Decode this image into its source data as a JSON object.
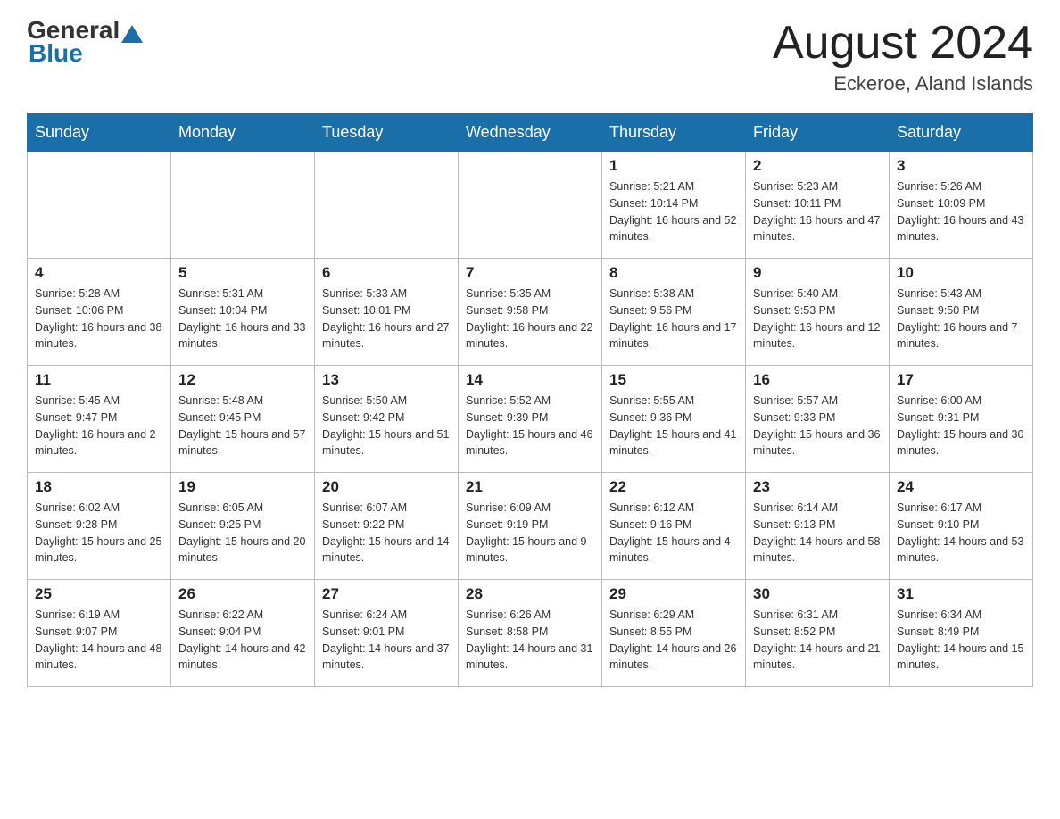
{
  "header": {
    "logo": {
      "general": "General",
      "blue": "Blue"
    },
    "title": "August 2024",
    "subtitle": "Eckeroe, Aland Islands"
  },
  "days_of_week": [
    "Sunday",
    "Monday",
    "Tuesday",
    "Wednesday",
    "Thursday",
    "Friday",
    "Saturday"
  ],
  "weeks": [
    [
      {
        "day": "",
        "sunrise": "",
        "sunset": "",
        "daylight": ""
      },
      {
        "day": "",
        "sunrise": "",
        "sunset": "",
        "daylight": ""
      },
      {
        "day": "",
        "sunrise": "",
        "sunset": "",
        "daylight": ""
      },
      {
        "day": "",
        "sunrise": "",
        "sunset": "",
        "daylight": ""
      },
      {
        "day": "1",
        "sunrise": "Sunrise: 5:21 AM",
        "sunset": "Sunset: 10:14 PM",
        "daylight": "Daylight: 16 hours and 52 minutes."
      },
      {
        "day": "2",
        "sunrise": "Sunrise: 5:23 AM",
        "sunset": "Sunset: 10:11 PM",
        "daylight": "Daylight: 16 hours and 47 minutes."
      },
      {
        "day": "3",
        "sunrise": "Sunrise: 5:26 AM",
        "sunset": "Sunset: 10:09 PM",
        "daylight": "Daylight: 16 hours and 43 minutes."
      }
    ],
    [
      {
        "day": "4",
        "sunrise": "Sunrise: 5:28 AM",
        "sunset": "Sunset: 10:06 PM",
        "daylight": "Daylight: 16 hours and 38 minutes."
      },
      {
        "day": "5",
        "sunrise": "Sunrise: 5:31 AM",
        "sunset": "Sunset: 10:04 PM",
        "daylight": "Daylight: 16 hours and 33 minutes."
      },
      {
        "day": "6",
        "sunrise": "Sunrise: 5:33 AM",
        "sunset": "Sunset: 10:01 PM",
        "daylight": "Daylight: 16 hours and 27 minutes."
      },
      {
        "day": "7",
        "sunrise": "Sunrise: 5:35 AM",
        "sunset": "Sunset: 9:58 PM",
        "daylight": "Daylight: 16 hours and 22 minutes."
      },
      {
        "day": "8",
        "sunrise": "Sunrise: 5:38 AM",
        "sunset": "Sunset: 9:56 PM",
        "daylight": "Daylight: 16 hours and 17 minutes."
      },
      {
        "day": "9",
        "sunrise": "Sunrise: 5:40 AM",
        "sunset": "Sunset: 9:53 PM",
        "daylight": "Daylight: 16 hours and 12 minutes."
      },
      {
        "day": "10",
        "sunrise": "Sunrise: 5:43 AM",
        "sunset": "Sunset: 9:50 PM",
        "daylight": "Daylight: 16 hours and 7 minutes."
      }
    ],
    [
      {
        "day": "11",
        "sunrise": "Sunrise: 5:45 AM",
        "sunset": "Sunset: 9:47 PM",
        "daylight": "Daylight: 16 hours and 2 minutes."
      },
      {
        "day": "12",
        "sunrise": "Sunrise: 5:48 AM",
        "sunset": "Sunset: 9:45 PM",
        "daylight": "Daylight: 15 hours and 57 minutes."
      },
      {
        "day": "13",
        "sunrise": "Sunrise: 5:50 AM",
        "sunset": "Sunset: 9:42 PM",
        "daylight": "Daylight: 15 hours and 51 minutes."
      },
      {
        "day": "14",
        "sunrise": "Sunrise: 5:52 AM",
        "sunset": "Sunset: 9:39 PM",
        "daylight": "Daylight: 15 hours and 46 minutes."
      },
      {
        "day": "15",
        "sunrise": "Sunrise: 5:55 AM",
        "sunset": "Sunset: 9:36 PM",
        "daylight": "Daylight: 15 hours and 41 minutes."
      },
      {
        "day": "16",
        "sunrise": "Sunrise: 5:57 AM",
        "sunset": "Sunset: 9:33 PM",
        "daylight": "Daylight: 15 hours and 36 minutes."
      },
      {
        "day": "17",
        "sunrise": "Sunrise: 6:00 AM",
        "sunset": "Sunset: 9:31 PM",
        "daylight": "Daylight: 15 hours and 30 minutes."
      }
    ],
    [
      {
        "day": "18",
        "sunrise": "Sunrise: 6:02 AM",
        "sunset": "Sunset: 9:28 PM",
        "daylight": "Daylight: 15 hours and 25 minutes."
      },
      {
        "day": "19",
        "sunrise": "Sunrise: 6:05 AM",
        "sunset": "Sunset: 9:25 PM",
        "daylight": "Daylight: 15 hours and 20 minutes."
      },
      {
        "day": "20",
        "sunrise": "Sunrise: 6:07 AM",
        "sunset": "Sunset: 9:22 PM",
        "daylight": "Daylight: 15 hours and 14 minutes."
      },
      {
        "day": "21",
        "sunrise": "Sunrise: 6:09 AM",
        "sunset": "Sunset: 9:19 PM",
        "daylight": "Daylight: 15 hours and 9 minutes."
      },
      {
        "day": "22",
        "sunrise": "Sunrise: 6:12 AM",
        "sunset": "Sunset: 9:16 PM",
        "daylight": "Daylight: 15 hours and 4 minutes."
      },
      {
        "day": "23",
        "sunrise": "Sunrise: 6:14 AM",
        "sunset": "Sunset: 9:13 PM",
        "daylight": "Daylight: 14 hours and 58 minutes."
      },
      {
        "day": "24",
        "sunrise": "Sunrise: 6:17 AM",
        "sunset": "Sunset: 9:10 PM",
        "daylight": "Daylight: 14 hours and 53 minutes."
      }
    ],
    [
      {
        "day": "25",
        "sunrise": "Sunrise: 6:19 AM",
        "sunset": "Sunset: 9:07 PM",
        "daylight": "Daylight: 14 hours and 48 minutes."
      },
      {
        "day": "26",
        "sunrise": "Sunrise: 6:22 AM",
        "sunset": "Sunset: 9:04 PM",
        "daylight": "Daylight: 14 hours and 42 minutes."
      },
      {
        "day": "27",
        "sunrise": "Sunrise: 6:24 AM",
        "sunset": "Sunset: 9:01 PM",
        "daylight": "Daylight: 14 hours and 37 minutes."
      },
      {
        "day": "28",
        "sunrise": "Sunrise: 6:26 AM",
        "sunset": "Sunset: 8:58 PM",
        "daylight": "Daylight: 14 hours and 31 minutes."
      },
      {
        "day": "29",
        "sunrise": "Sunrise: 6:29 AM",
        "sunset": "Sunset: 8:55 PM",
        "daylight": "Daylight: 14 hours and 26 minutes."
      },
      {
        "day": "30",
        "sunrise": "Sunrise: 6:31 AM",
        "sunset": "Sunset: 8:52 PM",
        "daylight": "Daylight: 14 hours and 21 minutes."
      },
      {
        "day": "31",
        "sunrise": "Sunrise: 6:34 AM",
        "sunset": "Sunset: 8:49 PM",
        "daylight": "Daylight: 14 hours and 15 minutes."
      }
    ]
  ]
}
